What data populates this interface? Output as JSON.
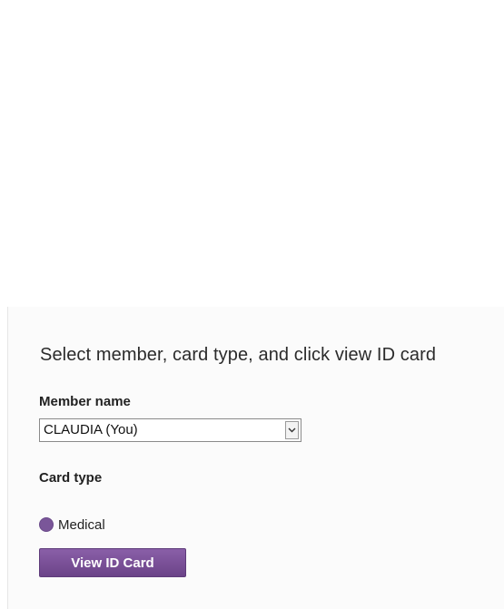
{
  "form": {
    "instruction": "Select member, card type, and click view ID card",
    "member_label": "Member name",
    "member_selected": "CLAUDIA (You)",
    "card_type_label": "Card type",
    "card_type_option": "Medical",
    "view_button_label": "View ID Card"
  },
  "colors": {
    "accent": "#7a5699",
    "button": "#6b4388"
  },
  "icons": {
    "dropdown": "chevron-down-icon"
  }
}
